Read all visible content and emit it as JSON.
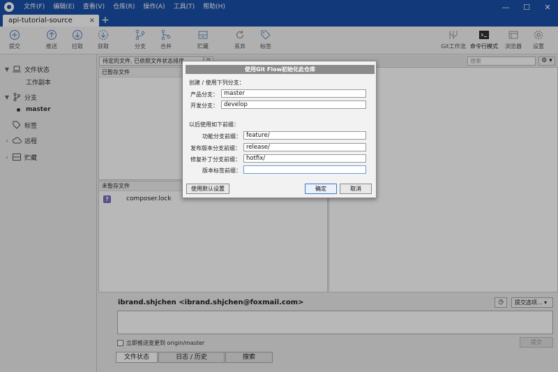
{
  "menu": {
    "items": [
      "文件(F)",
      "编辑(E)",
      "查看(V)",
      "仓库(R)",
      "操作(A)",
      "工具(T)",
      "帮助(H)"
    ]
  },
  "window": {
    "minimize": "—",
    "maximize": "☐",
    "close": "✕"
  },
  "tabs": {
    "active_label": "api-tutorial-source",
    "close": "×",
    "add": "+"
  },
  "toolbar": {
    "commit": "提交",
    "push": "推送",
    "pull": "拉取",
    "fetch": "获取",
    "branch": "分支",
    "merge": "合并",
    "stash": "贮藏",
    "discard": "丢弃",
    "tag": "标签",
    "git_flow": "Git工作流",
    "terminal": "命令行模式",
    "browser": "浏览器",
    "settings": "设置"
  },
  "sidebar": {
    "file_status": "文件状态",
    "working_copy": "工作副本",
    "branches": "分支",
    "current_branch": "master",
    "tags": "标签",
    "remotes": "远程",
    "stashes": "贮藏"
  },
  "files": {
    "filter": "待定的文件, 已依照文件状态排序",
    "list_mode": "☰ ▾",
    "search_placeholder": "搜索",
    "options": "⚙ ▾",
    "staged_header": "已暂存文件",
    "unstaged_header": "未暂存文件",
    "unstaged_files": [
      {
        "status": "?",
        "name": "composer.lock"
      }
    ]
  },
  "commit": {
    "author": "ibrand.shjchen <ibrand.shjchen@foxmail.com>",
    "history_icon": "◷",
    "options": "提交选项... ▾",
    "push_label": "立即推送变更到 origin/master",
    "commit_button": "提交"
  },
  "bottom_tabs": [
    "文件状态",
    "日志 / 历史",
    "搜索"
  ],
  "dialog": {
    "title": "使用Git Flow初始化此仓库",
    "section_branches": "创建 / 使用下列分支：",
    "production_label": "产品分支：",
    "production_value": "master",
    "develop_label": "开发分支：",
    "develop_value": "develop",
    "section_prefixes": "以后使用如下前缀：",
    "feature_label": "功能分支前缀：",
    "feature_value": "feature/",
    "release_label": "发布版本分支前缀：",
    "release_value": "release/",
    "hotfix_label": "修复补丁分支前缀：",
    "hotfix_value": "hotfix/",
    "version_tag_label": "版本标签前缀：",
    "version_tag_value": "",
    "defaults_button": "使用默认设置",
    "ok_button": "确定",
    "cancel_button": "取消"
  },
  "colors": {
    "titlebar": "#1a4fa8",
    "untracked_badge": "#7e6bbf",
    "dialog_title": "#8a8a8a"
  }
}
